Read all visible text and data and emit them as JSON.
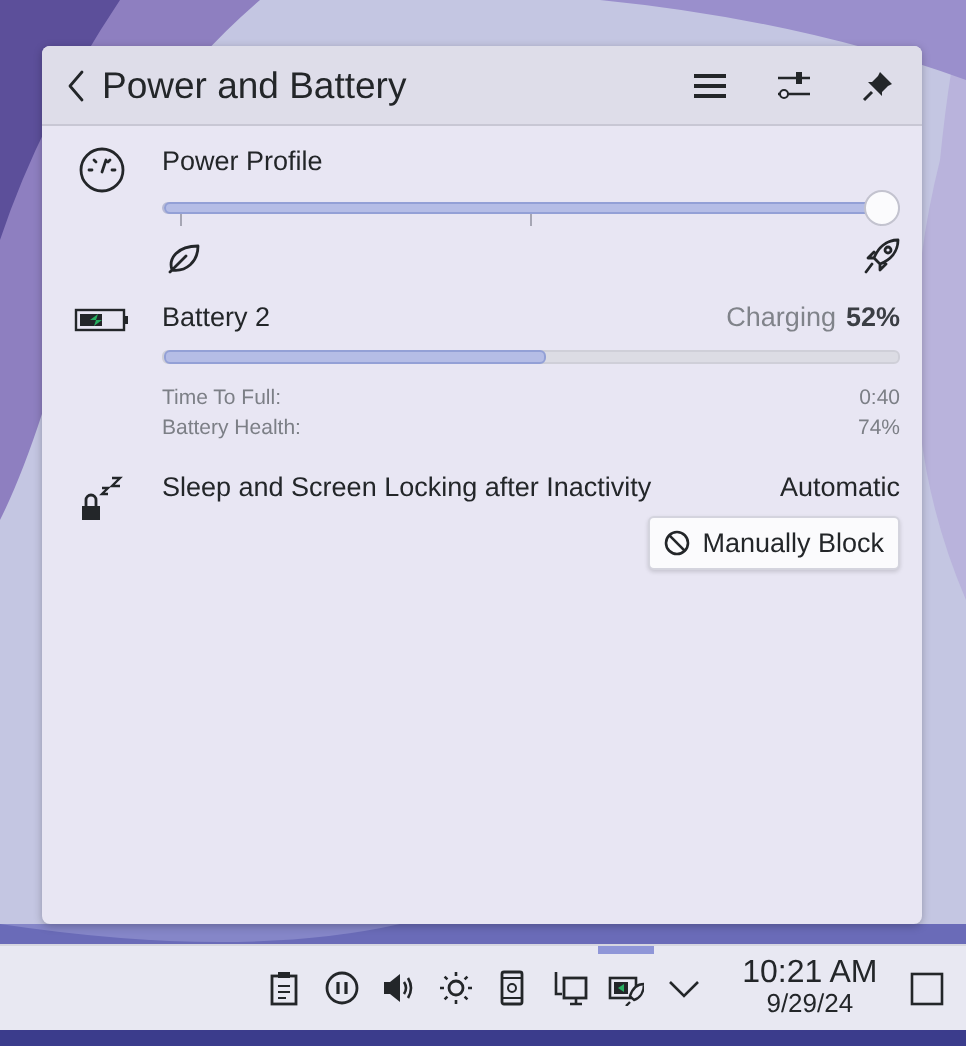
{
  "header": {
    "title": "Power and Battery"
  },
  "power_profile": {
    "label": "Power Profile",
    "level": 1
  },
  "battery": {
    "name": "Battery 2",
    "status": "Charging",
    "percent": "52%",
    "level": 0.52,
    "details": [
      {
        "label": "Time To Full:",
        "value": "0:40"
      },
      {
        "label": "Battery Health:",
        "value": "74%"
      }
    ]
  },
  "inhibition": {
    "label": "Sleep and Screen Locking after Inactivity",
    "mode": "Automatic",
    "button": "Manually Block"
  },
  "taskbar": {
    "tray": [
      {
        "kind": "clipboard",
        "selected": false
      },
      {
        "kind": "media",
        "selected": false
      },
      {
        "kind": "volume",
        "selected": false
      },
      {
        "kind": "brightness",
        "selected": false
      },
      {
        "kind": "phone",
        "selected": false
      },
      {
        "kind": "network",
        "selected": false
      },
      {
        "kind": "power",
        "selected": true
      },
      {
        "kind": "expand",
        "selected": false
      }
    ],
    "time": "10:21 AM",
    "date": "9/29/24"
  }
}
